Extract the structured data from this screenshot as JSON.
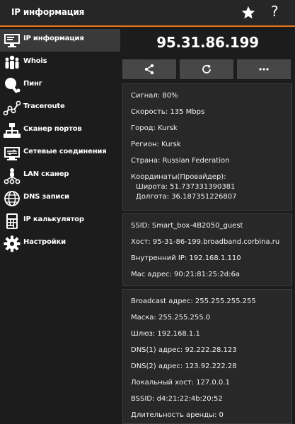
{
  "appbar": {
    "title": "IP информация",
    "help": "?"
  },
  "sidebar": {
    "items": [
      {
        "label": "IP информация"
      },
      {
        "label": "Whois"
      },
      {
        "label": "Пинг"
      },
      {
        "label": "Traceroute"
      },
      {
        "label": "Сканер портов"
      },
      {
        "label": "Сетевые соединения"
      },
      {
        "label": "LAN сканер"
      },
      {
        "label": "DNS записи"
      },
      {
        "label": "IP калькулятор"
      },
      {
        "label": "Настройки"
      }
    ]
  },
  "main": {
    "ip": "95.31.86.199",
    "location": {
      "signal": "Сигнал: 80%",
      "speed": "Скорость: 135 Mbps",
      "city": "Город: Kursk",
      "region": "Регион: Kursk",
      "country": "Страна: Russian Federation",
      "coords_title": "Координаты(Провайдер):",
      "lat": "Широта: 51.737331390381",
      "lon": "Долгота: 36.187351226807"
    },
    "wifi": {
      "ssid": "SSID: Smart_box-4B2050_guest",
      "host": "Хост: 95-31-86-199.broadband.corbina.ru",
      "internal_ip": "Внутренний IP: 192.168.1.110",
      "mac": "Mac адрес: 90:21:81:25:2d:6a"
    },
    "net": {
      "broadcast": "Broadcast адрес: 255.255.255.255",
      "mask": "Маска: 255.255.255.0",
      "gateway": "Шлюз: 192.168.1.1",
      "dns1": "DNS(1) адрес: 92.222.28.123",
      "dns2": "DNS(2) адрес: 123.92.222.28",
      "local_host": "Локальный хост: 127.0.0.1",
      "bssid": "BSSID: d4:21:22:4b:20:52",
      "lease": "Длительность аренды: 0"
    }
  },
  "colors": {
    "accent": "#e8741c",
    "background": "#1c1c1c",
    "card": "#282828",
    "button": "#474747"
  }
}
